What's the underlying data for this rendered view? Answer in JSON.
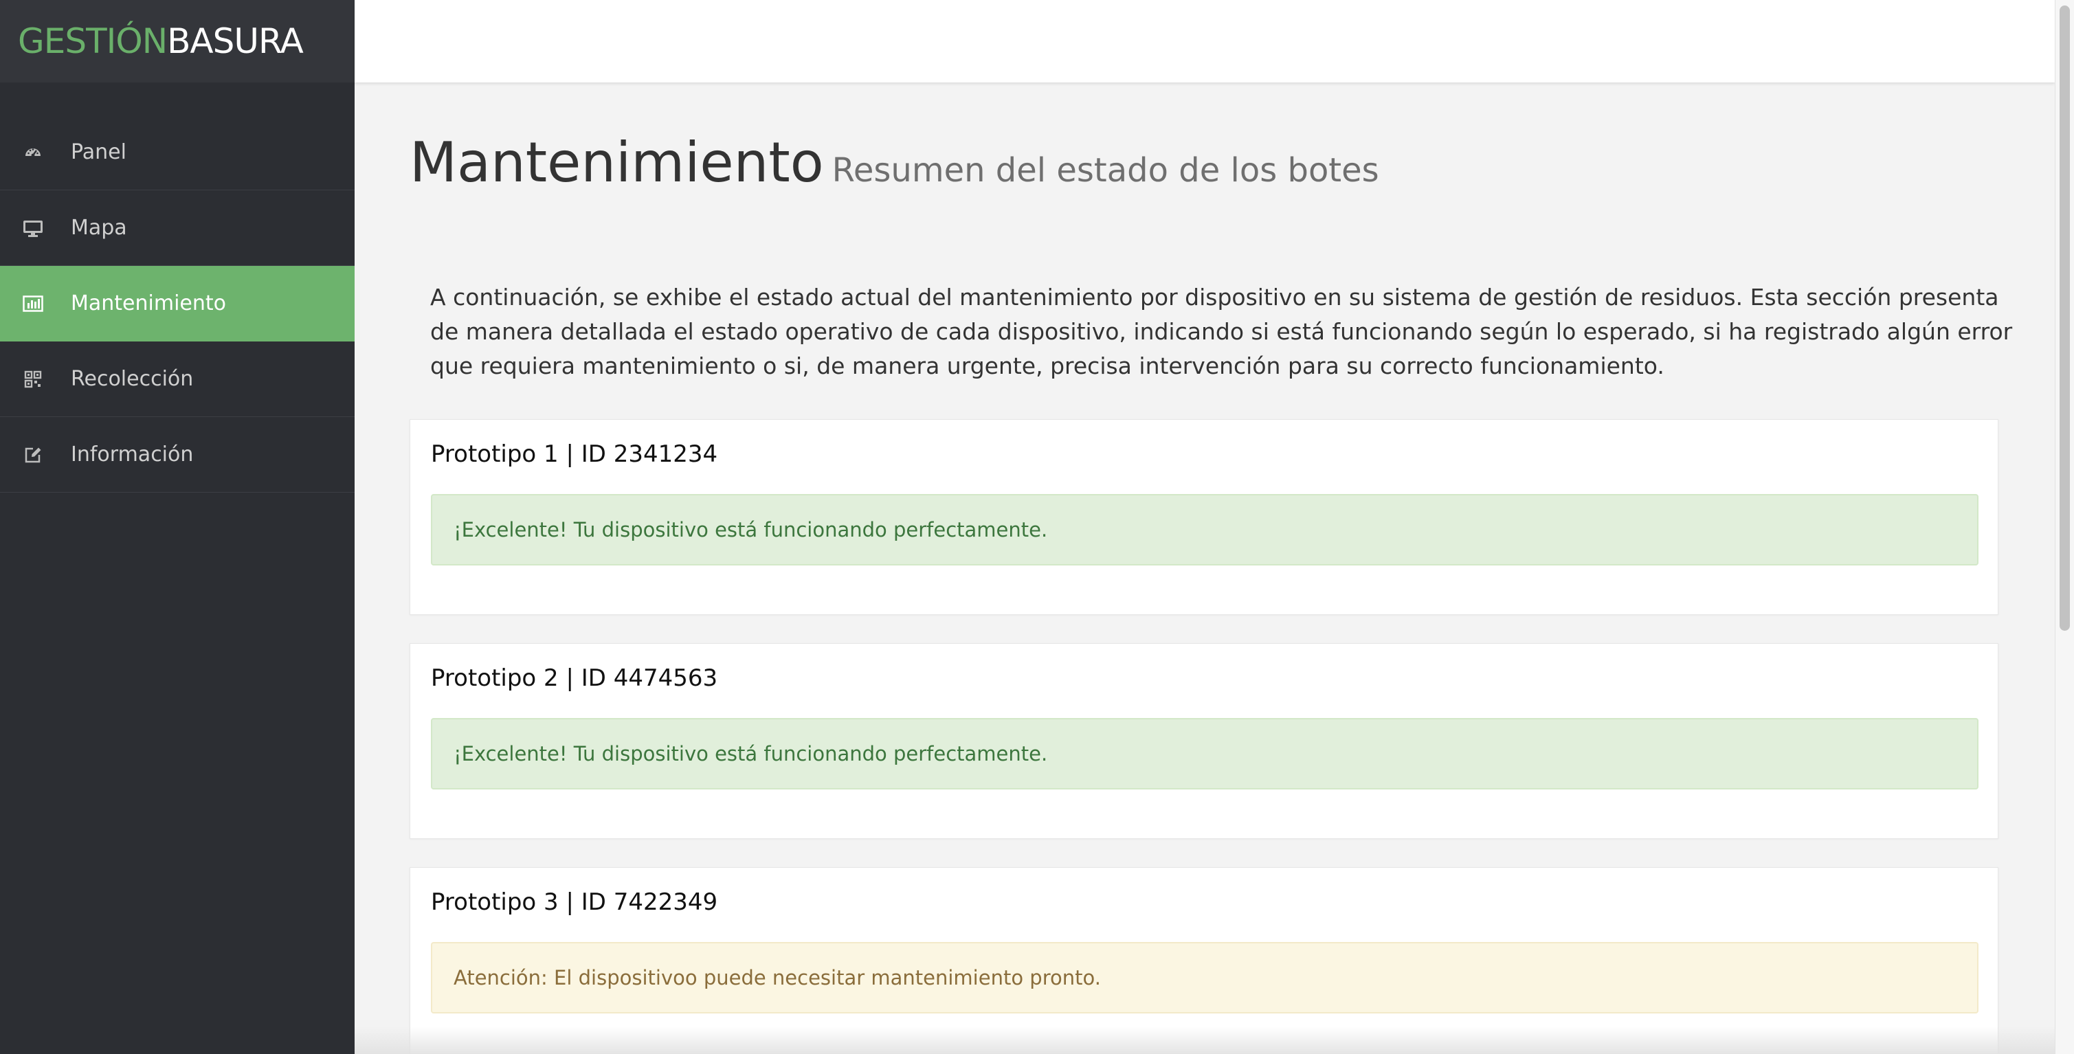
{
  "brand": {
    "part1": "GESTIÓN",
    "part2": "BASURA"
  },
  "sidebar": {
    "items": [
      {
        "label": "Panel",
        "icon": "dashboard-icon",
        "active": false
      },
      {
        "label": "Mapa",
        "icon": "monitor-icon",
        "active": false
      },
      {
        "label": "Mantenimiento",
        "icon": "bar-chart-icon",
        "active": true
      },
      {
        "label": "Recolección",
        "icon": "qr-code-icon",
        "active": false
      },
      {
        "label": "Información",
        "icon": "edit-icon",
        "active": false
      }
    ]
  },
  "page": {
    "title": "Mantenimiento",
    "subtitle": "Resumen del estado de los botes",
    "intro": "A continuación, se exhibe el estado actual del mantenimiento por dispositivo en su sistema de gestión de residuos. Esta sección presenta de manera detallada el estado operativo de cada dispositivo, indicando si está funcionando según lo esperado, si ha registrado algún error que requiera mantenimiento o si, de manera urgente, precisa intervención para su correcto funcionamiento."
  },
  "devices": [
    {
      "title": "Prototipo 1 | ID 2341234",
      "status": "success",
      "message": "¡Excelente! Tu dispositivo está funcionando perfectamente."
    },
    {
      "title": "Prototipo 2 | ID 4474563",
      "status": "success",
      "message": "¡Excelente! Tu dispositivo está funcionando perfectamente."
    },
    {
      "title": "Prototipo 3 | ID 7422349",
      "status": "warning",
      "message": "Atención: El dispositivoo puede necesitar mantenimiento pronto."
    }
  ],
  "colors": {
    "sidebar_bg": "#2c2e33",
    "accent_green": "#6db36d",
    "success_bg": "#e1efdb",
    "success_text": "#3c763d",
    "warning_bg": "#fbf6e2",
    "warning_text": "#8a6d3b"
  }
}
